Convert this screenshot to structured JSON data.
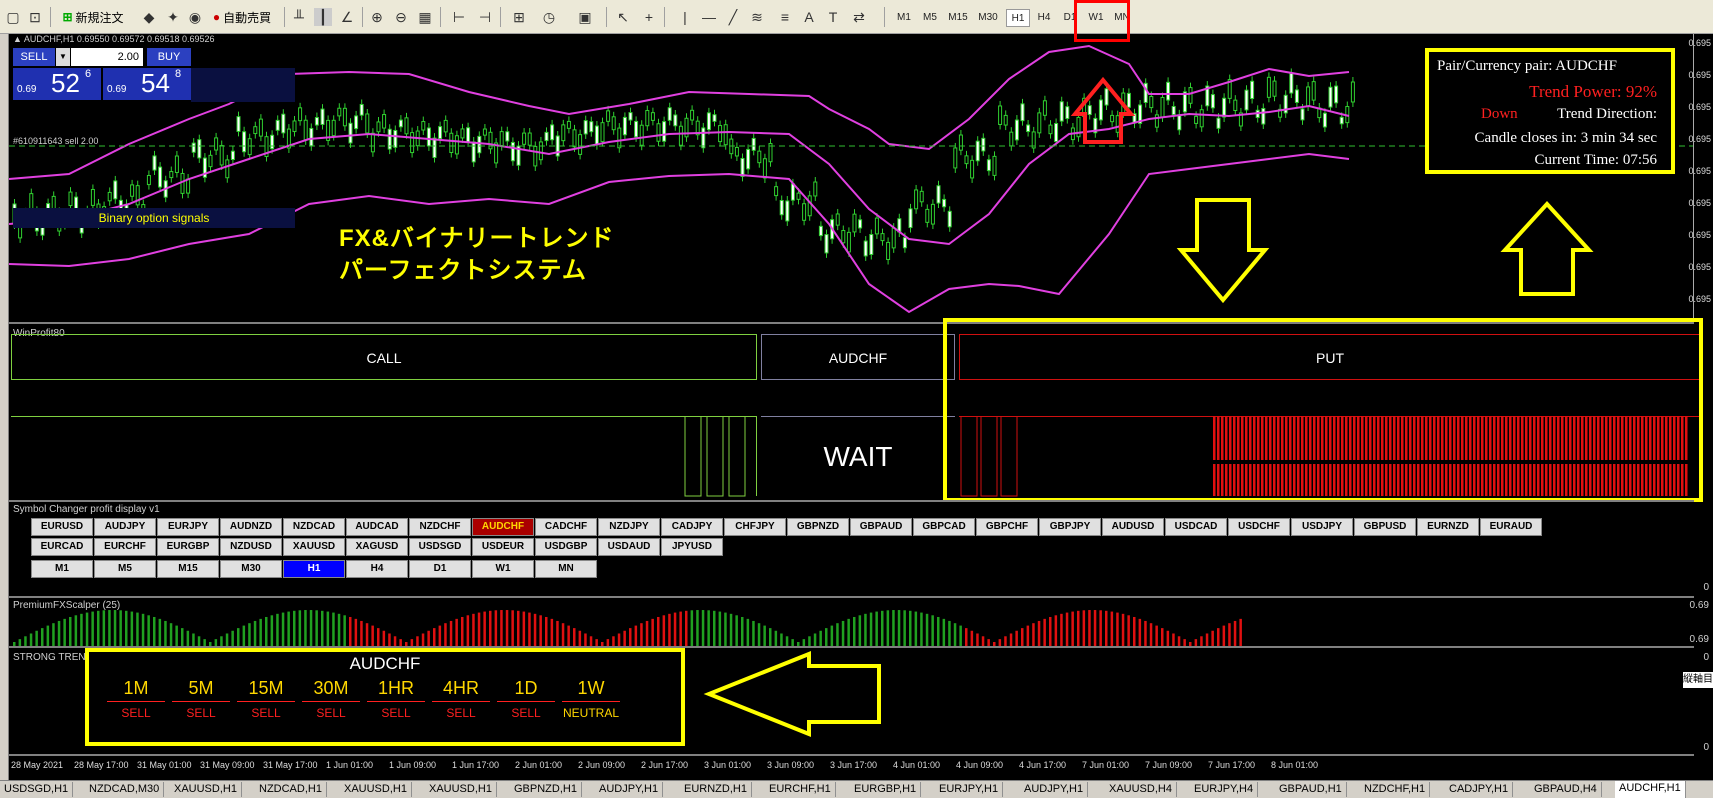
{
  "toolbar": {
    "new_order": "新規注文",
    "auto_trade": "自動売買",
    "timeframes": [
      "M1",
      "M5",
      "M15",
      "M30",
      "H1",
      "H4",
      "D1",
      "W1",
      "MN"
    ]
  },
  "chart": {
    "header": "AUDCHF,H1  0.69550 0.69572 0.69518 0.69526",
    "sell_label": "SELL",
    "buy_label": "BUY",
    "lot": "2.00",
    "sell_prefix": "0.69",
    "sell_big": "52",
    "sell_sup": "6",
    "buy_prefix": "0.69",
    "buy_big": "54",
    "buy_sup": "8",
    "order_line": "#610911643 sell 2.00",
    "signals_label": "Binary option signals",
    "jp_title_1": "FX&バイナリートレンド",
    "jp_title_2": "パーフェクトシステム",
    "price_scale": [
      "0.695",
      "0.695",
      "0.695",
      "0.695",
      "0.695",
      "0.695",
      "0.695",
      "0.695",
      "0.695"
    ]
  },
  "info_box": {
    "pair": "Pair/Currency pair: AUDCHF",
    "trend_power": "Trend Power: 92%",
    "down": "Down",
    "trend_direction": "Trend Direction:",
    "candle_closes": "Candle closes in: 3 min 34 sec",
    "current_time": "Current Time: 07:56",
    "colors": {
      "text": "#ffffff",
      "power": "#ff2020",
      "border": "#ffff00"
    }
  },
  "winprofit": {
    "label": "WinProfit80",
    "call": "CALL",
    "pair": "AUDCHF",
    "put": "PUT",
    "status": "WAIT",
    "colors": {
      "call": "#7fd040",
      "put": "#d01010",
      "mid": "#8080a0"
    }
  },
  "symbol_changer": {
    "label": "Symbol Changer profit display  v1",
    "row1": [
      "EURUSD",
      "AUDJPY",
      "EURJPY",
      "AUDNZD",
      "NZDCAD",
      "AUDCAD",
      "NZDCHF",
      "AUDCHF",
      "CADCHF",
      "NZDJPY",
      "CADJPY",
      "CHFJPY",
      "GBPNZD",
      "GBPAUD",
      "GBPCAD",
      "GBPCHF",
      "GBPJPY",
      "AUDUSD",
      "USDCAD",
      "USDCHF",
      "USDJPY",
      "GBPUSD",
      "EURNZD",
      "EURAUD"
    ],
    "row2": [
      "EURCAD",
      "EURCHF",
      "EURGBP",
      "NZDUSD",
      "XAUUSD",
      "XAGUSD",
      "USDSGD",
      "USDEUR",
      "USDGBP",
      "USDAUD",
      "JPYUSD"
    ],
    "row3": [
      "M1",
      "M5",
      "M15",
      "M30",
      "H1",
      "H4",
      "D1",
      "W1",
      "MN"
    ],
    "active_symbol": "AUDCHF",
    "active_tf": "H1",
    "scale_zero": "0"
  },
  "scalper": {
    "label": "PremiumFXScalper (25)",
    "scale": [
      "0.69",
      "0.69"
    ]
  },
  "strong_trend": {
    "label": "STRONG TREN",
    "pair": "AUDCHF",
    "timeframes": [
      {
        "tf": "1M",
        "signal": "SELL"
      },
      {
        "tf": "5M",
        "signal": "SELL"
      },
      {
        "tf": "15M",
        "signal": "SELL"
      },
      {
        "tf": "30M",
        "signal": "SELL"
      },
      {
        "tf": "1HR",
        "signal": "SELL"
      },
      {
        "tf": "4HR",
        "signal": "SELL"
      },
      {
        "tf": "1D",
        "signal": "SELL"
      },
      {
        "tf": "1W",
        "signal": "NEUTRAL"
      }
    ],
    "side_note": "縦軸目",
    "scale": [
      "0",
      "0"
    ]
  },
  "dates": [
    "28 May 2021",
    "28 May 17:00",
    "31 May 01:00",
    "31 May 09:00",
    "31 May 17:00",
    "1 Jun 01:00",
    "1 Jun 09:00",
    "1 Jun 17:00",
    "2 Jun 01:00",
    "2 Jun 09:00",
    "2 Jun 17:00",
    "3 Jun 01:00",
    "3 Jun 09:00",
    "3 Jun 17:00",
    "4 Jun 01:00",
    "4 Jun 09:00",
    "4 Jun 17:00",
    "7 Jun 01:00",
    "7 Jun 09:00",
    "7 Jun 17:00",
    "8 Jun 01:00"
  ],
  "tabs": [
    "USDSGD,H1",
    "NZDCAD,M30",
    "XAUUSD,H1",
    "NZDCAD,H1",
    "XAUUSD,H1",
    "XAUUSD,H1",
    "GBPNZD,H1",
    "AUDJPY,H1",
    "EURNZD,H1",
    "EURCHF,H1",
    "EURGBP,H1",
    "EURJPY,H1",
    "AUDJPY,H1",
    "XAUUSD,H4",
    "EURJPY,H4",
    "GBPAUD,H1",
    "NZDCHF,H1",
    "CADJPY,H1",
    "GBPAUD,H4",
    "AUDCHF,H1"
  ]
}
